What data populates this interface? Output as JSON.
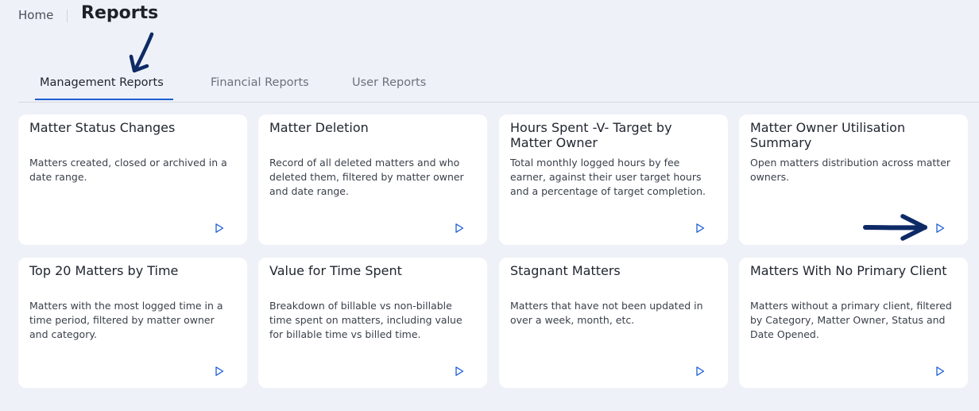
{
  "breadcrumb": {
    "home": "Home",
    "title": "Reports"
  },
  "tabs": [
    {
      "label": "Management Reports"
    },
    {
      "label": "Financial Reports"
    },
    {
      "label": "User Reports"
    }
  ],
  "active_tab": "Management Reports",
  "cards": [
    {
      "title": "Matter Status Changes",
      "description": "Matters created, closed or archived in a date range."
    },
    {
      "title": "Matter Deletion",
      "description": "Record of all deleted matters and who deleted them, filtered by matter owner and date range."
    },
    {
      "title": "Hours Spent -V- Target by Matter Owner",
      "description": "Total monthly logged hours by fee earner, against their user target hours and a percentage of target completion."
    },
    {
      "title": "Matter Owner Utilisation Summary",
      "description": "Open matters distribution across matter owners."
    },
    {
      "title": "Top 20 Matters by Time",
      "description": "Matters with the most logged time in a time period, filtered by matter owner and category."
    },
    {
      "title": "Value for Time Spent",
      "description": "Breakdown of billable vs non-billable time spent on matters, including value for billable time vs billed time."
    },
    {
      "title": "Stagnant Matters",
      "description": "Matters that have not been updated in over a week, month, etc."
    },
    {
      "title": "Matters With No Primary Client",
      "description": "Matters without a primary client, filtered by Category, Matter Owner, Status and Date Opened."
    }
  ],
  "colors": {
    "accent": "#1d5fd6",
    "annotation": "#0e2a66",
    "background": "#eef1f7",
    "card": "#ffffff"
  },
  "icons": {
    "run_report": "play-outline-icon"
  }
}
